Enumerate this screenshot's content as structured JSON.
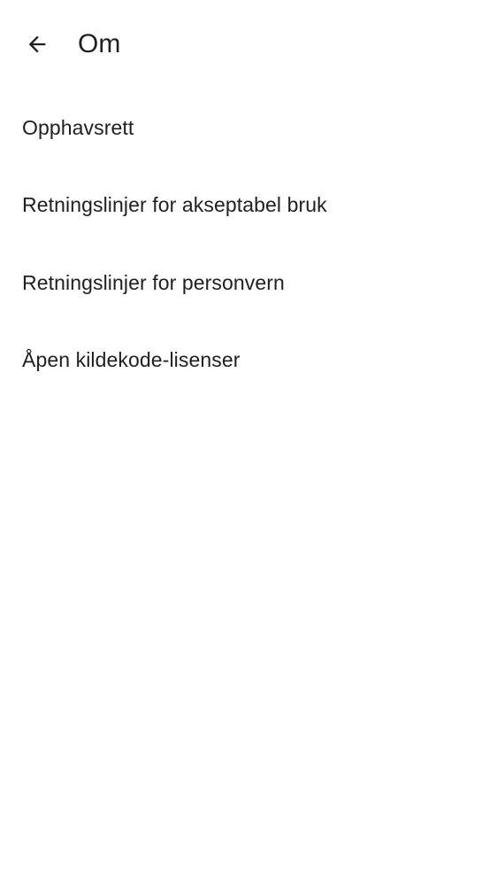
{
  "header": {
    "title": "Om",
    "back_icon": "arrow-back-icon"
  },
  "menu": {
    "items": [
      {
        "label": "Opphavsrett"
      },
      {
        "label": "Retningslinjer for akseptabel bruk"
      },
      {
        "label": "Retningslinjer for personvern"
      },
      {
        "label": "Åpen kildekode-lisenser"
      }
    ]
  },
  "colors": {
    "background": "#ffffff",
    "text": "#1f1f1f"
  }
}
